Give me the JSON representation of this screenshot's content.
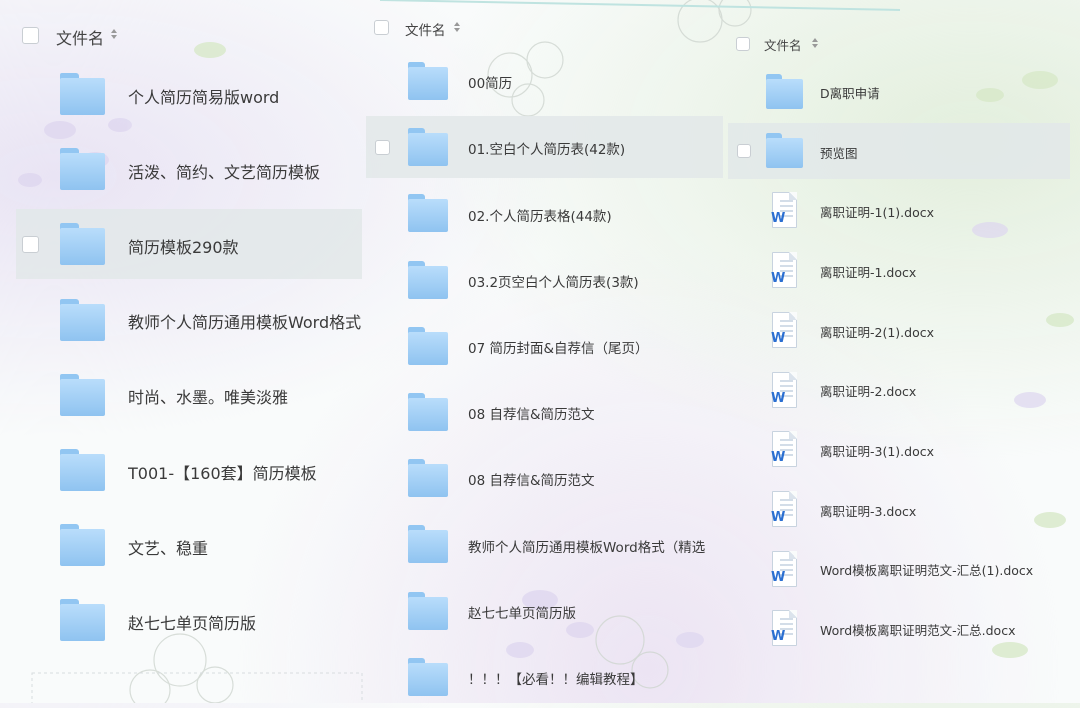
{
  "header_label": "文件名",
  "col1": {
    "items": [
      {
        "name": "个人简历简易版word"
      },
      {
        "name": "活泼、简约、文艺简历模板"
      },
      {
        "name": "简历模板290款"
      },
      {
        "name": "教师个人简历通用模板Word格式"
      },
      {
        "name": "时尚、水墨。唯美淡雅"
      },
      {
        "name": "T001-【160套】简历模板"
      },
      {
        "name": "文艺、稳重"
      },
      {
        "name": "赵七七单页简历版"
      }
    ]
  },
  "col2": {
    "items": [
      {
        "name": "00简历"
      },
      {
        "name": "01.空白个人简历表(42款)"
      },
      {
        "name": "02.个人简历表格(44款)"
      },
      {
        "name": "03.2页空白个人简历表(3款)"
      },
      {
        "name": "07 简历封面&自荐信（尾页）"
      },
      {
        "name": "08 自荐信&简历范文"
      },
      {
        "name": "08 自荐信&简历范文"
      },
      {
        "name": "教师个人简历通用模板Word格式（精选"
      },
      {
        "name": "赵七七单页简历版"
      },
      {
        "name": "！！！【必看！！编辑教程】"
      }
    ]
  },
  "col3": {
    "items": [
      {
        "name": "D离职申请"
      },
      {
        "name": "预览图"
      },
      {
        "name": "离职证明-1(1).docx"
      },
      {
        "name": "离职证明-1.docx"
      },
      {
        "name": "离职证明-2(1).docx"
      },
      {
        "name": "离职证明-2.docx"
      },
      {
        "name": "离职证明-3(1).docx"
      },
      {
        "name": "离职证明-3.docx"
      },
      {
        "name": "Word模板离职证明范文-汇总(1).docx"
      },
      {
        "name": "Word模板离职证明范文-汇总.docx"
      }
    ]
  },
  "icons": {
    "folder": "folder-icon",
    "doc": "word-doc-icon",
    "sort": "sort-icon"
  },
  "colors": {
    "folder": "#a6d1f7",
    "selected_row": "#e2e7e9",
    "word_blue": "#2b6fd1"
  }
}
